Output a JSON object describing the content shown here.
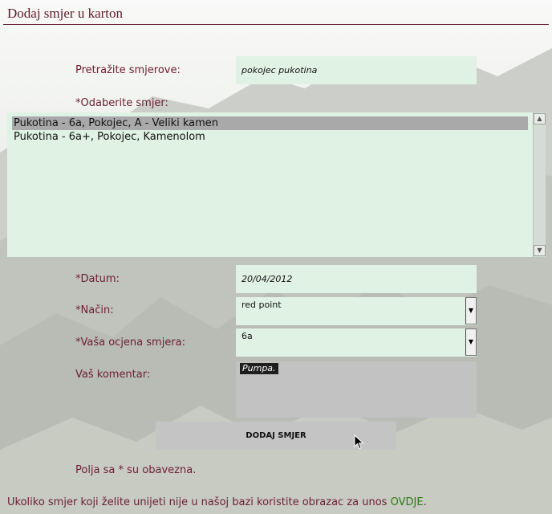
{
  "header": {
    "title": "Dodaj smjer u karton"
  },
  "search": {
    "label": "Pretražite smjerove:",
    "value": "pokojec pukotina"
  },
  "route_select": {
    "label": "*Odaberite smjer:",
    "options": [
      "Pukotina - 6a, Pokojec, A - Veliki kamen",
      "Pukotina - 6a+, Pokojec, Kamenolom"
    ],
    "selected_index": 0
  },
  "date": {
    "label": "*Datum:",
    "value": "20/04/2012"
  },
  "method": {
    "label": "*Način:",
    "value": "red point"
  },
  "grade": {
    "label": "*Vaša ocjena smjera:",
    "value": "6a"
  },
  "comment": {
    "label": "Vaš komentar:",
    "value": "Pumpa."
  },
  "submit": {
    "label": "DODAJ SMJER"
  },
  "required_note": "Polja sa * su obavezna.",
  "footer": {
    "text": "Ukoliko smjer koji želite unijeti nije u našoj bazi koristite obrazac za unos ",
    "link": "OVDJE",
    "end": "."
  },
  "colors": {
    "label": "#6b2034",
    "field_bg": "#e0f2e3",
    "selected_option": "#a9a9a9",
    "link": "#2a7a10"
  },
  "icons": {
    "scroll_up": "triangle-up-icon",
    "scroll_down": "triangle-down-icon",
    "dropdown": "triangle-down-icon",
    "cursor": "mouse-pointer-icon"
  }
}
